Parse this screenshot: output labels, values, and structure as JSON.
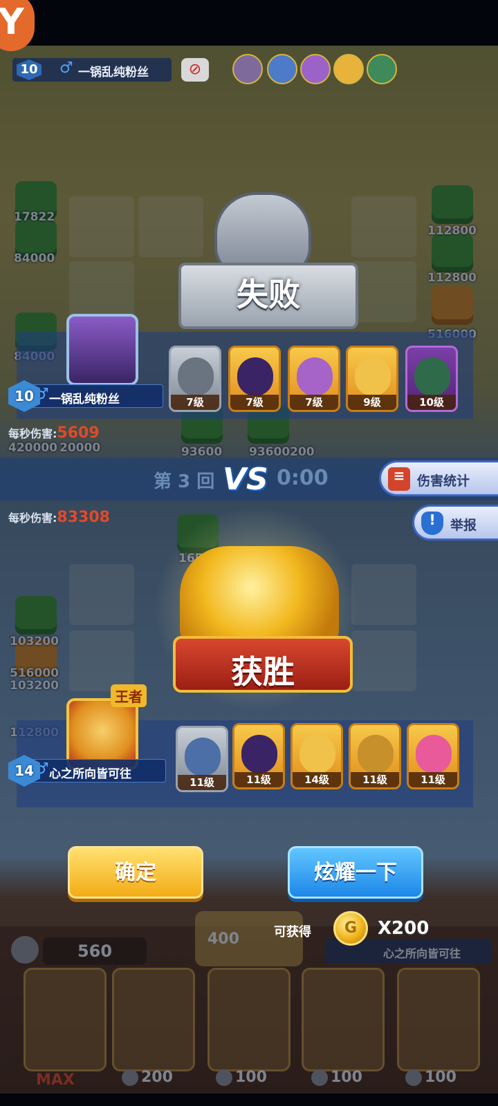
{
  "top_bar": {
    "level": "10",
    "gender_icon": "♂",
    "player_name": "一锅乱纯粉丝"
  },
  "defeat": {
    "title": "失败",
    "player": {
      "level": "10",
      "gender_icon": "♂",
      "name": "一锅乱纯粉丝"
    },
    "heroes": [
      {
        "level": "7级",
        "icon": "knight-hero-icon"
      },
      {
        "level": "7级",
        "icon": "mage-hero-icon"
      },
      {
        "level": "7级",
        "icon": "fairy-hero-icon"
      },
      {
        "level": "9级",
        "icon": "king-hero-icon"
      },
      {
        "level": "10级",
        "icon": "ghost-hero-icon"
      }
    ],
    "dps_label": "每秒伤害:",
    "dps_value": "5609"
  },
  "middle": {
    "vs": "VS",
    "round": "第 3 回",
    "timer": "0:00",
    "damage_stats": "伤害统计",
    "report": "举报",
    "dps_label": "每秒伤害:",
    "dps_value": "83308"
  },
  "victory": {
    "title": "获胜",
    "crown_label": "王者",
    "player": {
      "level": "14",
      "gender_icon": "♂",
      "name": "心之所向皆可往"
    },
    "heroes": [
      {
        "level": "11级",
        "icon": "gangster-hero-icon"
      },
      {
        "level": "11级",
        "icon": "mage-hero-icon"
      },
      {
        "level": "14级",
        "icon": "king-hero-icon"
      },
      {
        "level": "11级",
        "icon": "wood-hero-icon"
      },
      {
        "level": "11级",
        "icon": "clown-hero-icon"
      }
    ]
  },
  "actions": {
    "confirm": "确定",
    "show_off": "炫耀一下",
    "reward_label": "可获得",
    "reward_amount": "X200",
    "coin_icon": "G"
  },
  "background": {
    "numbers": [
      "17822",
      "84000",
      "84000",
      "420000",
      "20000",
      "112800",
      "112800",
      "516000",
      "93600",
      "93600200",
      "16526",
      "103200",
      "516000",
      "103200",
      "112800"
    ],
    "balance": "560",
    "dice_cost": "400",
    "opponent_name": "心之所向皆可往",
    "opponent_level": "14",
    "card_costs": [
      "200",
      "100",
      "100",
      "100"
    ],
    "max_label": "MAX"
  },
  "colors": {
    "panel": "#1e3c82",
    "gold": "#f3ac16",
    "blue_button": "#1d87e8",
    "dps_red": "#e04a2a"
  }
}
